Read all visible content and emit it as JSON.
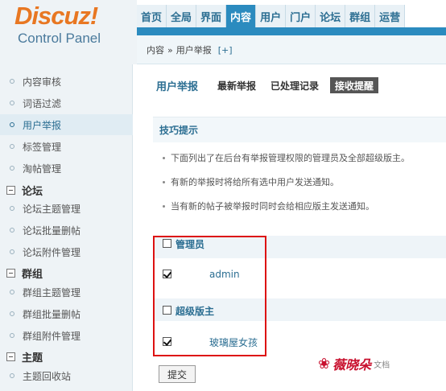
{
  "logo": {
    "brand": "Discuz!",
    "subtitle": "Control Panel"
  },
  "nav": [
    "首页",
    "全局",
    "界面",
    "内容",
    "用户",
    "门户",
    "论坛",
    "群组",
    "运营"
  ],
  "nav_active": "内容",
  "breadcrumb": {
    "section": "内容",
    "separator": "»",
    "page": "用户举报",
    "add": "[+]"
  },
  "sidebar": {
    "content_items": [
      "内容审核",
      "词语过滤",
      "用户举报",
      "标签管理",
      "淘帖管理"
    ],
    "active_item": "用户举报",
    "groups": [
      {
        "label": "论坛",
        "items": [
          "论坛主题管理",
          "论坛批量删帖",
          "论坛附件管理"
        ]
      },
      {
        "label": "群组",
        "items": [
          "群组主题管理",
          "群组批量删帖",
          "群组附件管理"
        ]
      },
      {
        "label": "主题",
        "items": [
          "主题回收站"
        ]
      }
    ]
  },
  "main": {
    "title": "用户举报",
    "tabs": [
      "最新举报",
      "已处理记录",
      "接收提醒"
    ],
    "selected_tab": "接收提醒",
    "tips_title": "技巧提示",
    "tips": [
      "下面列出了在后台有举报管理权限的管理员及全部超级版主。",
      "有新的举报时将给所有选中用户发送通知。",
      "当有新的帖子被举报时同时会给相应版主发送通知。"
    ],
    "groups": [
      {
        "label": "管理员",
        "checked": false,
        "users": [
          {
            "name": "admin",
            "checked": true
          }
        ]
      },
      {
        "label": "超级版主",
        "checked": false,
        "users": [
          {
            "name": "玻璃屋女孩",
            "checked": true
          }
        ]
      }
    ],
    "submit": "提交"
  },
  "watermark": {
    "brand": "薇晓朵",
    "suffix": "文档"
  },
  "colors": {
    "accent": "#2b8bbf",
    "logo": "#e87722",
    "highlight_box": "#dd1111"
  }
}
